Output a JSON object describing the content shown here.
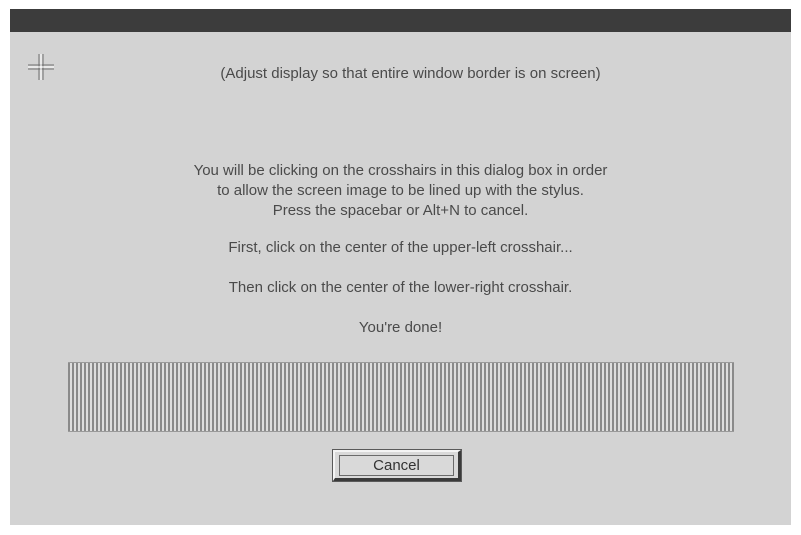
{
  "dialog": {
    "adjust_note": "(Adjust display so that entire window border is on screen)",
    "instruction_lines": [
      "You will be clicking on the crosshairs in this dialog box in order",
      "to allow the screen image to be lined up with the stylus.",
      "Press the spacebar or Alt+N to cancel."
    ],
    "step1": "First, click on the center of the upper-left crosshair...",
    "step2": "Then click on the center of the lower-right crosshair.",
    "step3": "You're done!",
    "cancel_label": "Cancel"
  },
  "icons": {
    "top_left_target": "crosshair-icon"
  },
  "colors": {
    "titlebar": "#3c3c3c",
    "dialog_background": "#d3d3d3",
    "text": "#4a4a4a"
  }
}
